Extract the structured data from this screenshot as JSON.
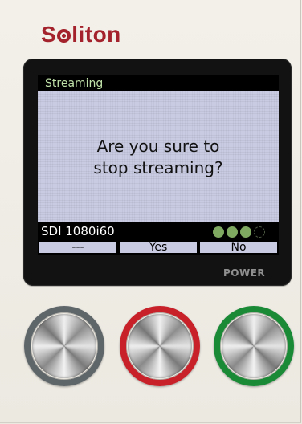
{
  "brand": {
    "name": "Soliton",
    "color": "#a3222b"
  },
  "screen": {
    "title": "Streaming",
    "message_line1": "Are you sure to",
    "message_line2": "stop streaming?",
    "video_format": "SDI 1080i60",
    "signal_indicators": {
      "lit": 3,
      "total": 4,
      "color": "#7fa860"
    },
    "softkeys": [
      "---",
      "Yes",
      "No"
    ],
    "background_color": "#c8cbe2"
  },
  "hardware": {
    "power_label": "POWER",
    "buttons": [
      {
        "name": "left",
        "ring_color": "#5f6669"
      },
      {
        "name": "center",
        "ring_color": "#c8212a"
      },
      {
        "name": "right",
        "ring_color": "#1a8a37"
      }
    ]
  }
}
